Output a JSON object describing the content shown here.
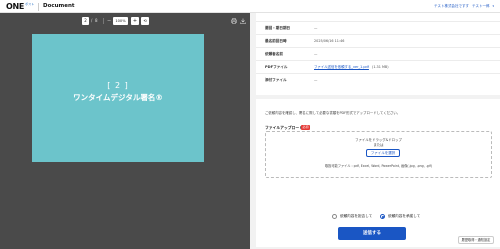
{
  "header": {
    "logo_main": "ONE",
    "logo_sub": "ポスト",
    "title": "Document",
    "company": "テスト株式会社ですす",
    "user_name": "テスト一郎",
    "caret": "▾"
  },
  "viewer": {
    "current_page": "2",
    "separator": "/",
    "total_pages": "8",
    "zoom_minus": "−",
    "zoom": "100%",
    "zoom_plus": "+",
    "zoom_reset": "⟲",
    "page_number_text": "[ 2 ]",
    "page_title_text": "ワンタイムデジタル署名®",
    "page_color": "#6cc4cb",
    "toolbar_icons": [
      "print-icon",
      "download-icon"
    ]
  },
  "info": {
    "rows": [
      {
        "label": "",
        "value": ""
      },
      {
        "label": "要回・期日期日",
        "value": "—"
      },
      {
        "label": "最名前回日時",
        "value": "2025/06/16 11:46"
      },
      {
        "label": "依頼者名前",
        "value": "—"
      },
      {
        "label": "PDFファイル",
        "link": "ファイル送信を依頼する_ver_1.pdf",
        "size": "(1.31 MB)"
      },
      {
        "label": "添付ファイル",
        "value": "—"
      }
    ]
  },
  "upload": {
    "description": "ご依頼内容を確認し、署名に際して必要な書類をPDF形式でアップロードしてください。",
    "label": "ファイルアップロード",
    "required": "必須",
    "dropzone_line1": "ファイルをドラッグ&ドロップ",
    "dropzone_line2": "または",
    "select_button": "ファイルを選択",
    "formats": "取扱可能ファイル : pdf, Excel, Word, PowerPoint, 画像(.jpg, .png, .gif)",
    "radio_reject": "依頼内容を拒否して",
    "radio_accept": "依頼内容を承諾して",
    "submit": "送信する"
  },
  "footer": {
    "history_button": "履歴取得・通知設定"
  },
  "colors": {
    "accent": "#1a56c4",
    "viewer_bg": "#4a4a4a",
    "required": "#e53935"
  }
}
